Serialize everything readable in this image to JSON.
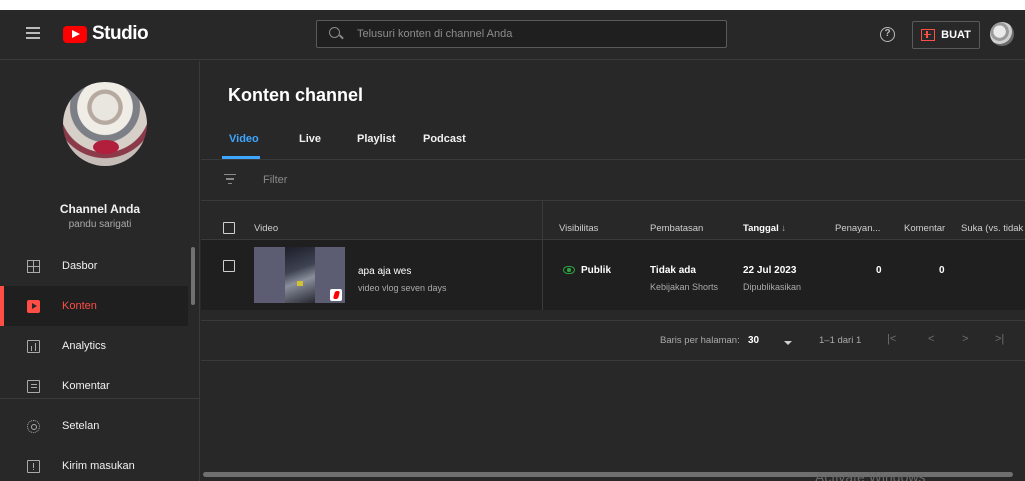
{
  "header": {
    "brand": "Studio",
    "search_placeholder": "Telusuri konten di channel Anda",
    "help_symbol": "?",
    "create_label": "BUAT"
  },
  "sidebar": {
    "channel_name": "Channel Anda",
    "channel_handle": "pandu sarigati",
    "items": [
      {
        "label": "Dasbor",
        "icon": "dashboard-icon",
        "active": false
      },
      {
        "label": "Konten",
        "icon": "content-icon",
        "active": true
      },
      {
        "label": "Analytics",
        "icon": "analytics-icon",
        "active": false
      },
      {
        "label": "Komentar",
        "icon": "comments-icon",
        "active": false
      },
      {
        "label": "Setelan",
        "icon": "settings-icon",
        "active": false
      },
      {
        "label": "Kirim masukan",
        "icon": "feedback-icon",
        "active": false
      }
    ]
  },
  "main": {
    "title": "Konten channel",
    "tabs": [
      {
        "label": "Video",
        "active": true
      },
      {
        "label": "Live",
        "active": false
      },
      {
        "label": "Playlist",
        "active": false
      },
      {
        "label": "Podcast",
        "active": false
      }
    ],
    "filter_label": "Filter",
    "columns": {
      "video": "Video",
      "visibility": "Visibilitas",
      "restrictions": "Pembatasan",
      "date": "Tanggal",
      "date_sort": "↓",
      "views": "Penayan...",
      "comments": "Komentar",
      "likes": "Suka (vs. tidak"
    },
    "rows": [
      {
        "title": "apa aja wes",
        "description": "video vlog seven days",
        "visibility": "Publik",
        "restriction": "Tidak ada",
        "restriction_detail": "Kebijakan Shorts",
        "date": "22 Jul 2023",
        "date_status": "Dipublikasikan",
        "views": "0",
        "comments": "0"
      }
    ],
    "pagination": {
      "rows_label": "Baris per halaman:",
      "rows_value": "30",
      "range": "1–1 dari 1",
      "first": "|<",
      "prev": "<",
      "next": ">",
      "last": ">|"
    }
  },
  "watermark": "Activate Windows",
  "colors": {
    "accent": "#3ea6ff",
    "brand_red": "#ff0000",
    "active_nav": "#ff4e45",
    "public_green": "#2ba640",
    "background": "#282828"
  }
}
